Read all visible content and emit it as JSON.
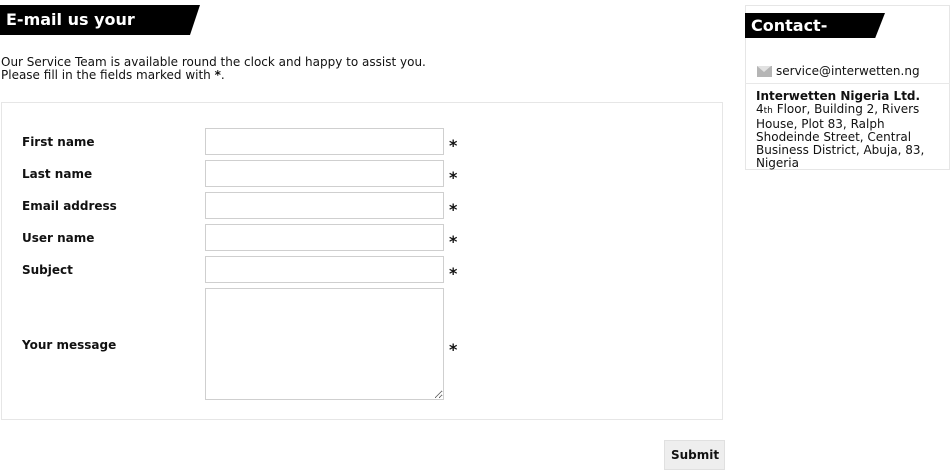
{
  "main_panel": {
    "title": "E-mail us your opinion",
    "intro_line1": "Our Service Team is available round the clock and happy to assist you.",
    "intro_line2_prefix": "Please fill in the fields marked with",
    "intro_line2_star": "*",
    "intro_line2_suffix": "."
  },
  "form": {
    "fields": [
      {
        "label": "First name",
        "value": "",
        "placeholder": ""
      },
      {
        "label": "Last name",
        "value": "",
        "placeholder": ""
      },
      {
        "label": "Email address",
        "value": "",
        "placeholder": ""
      },
      {
        "label": "User name",
        "value": "",
        "placeholder": ""
      },
      {
        "label": "Subject",
        "value": "",
        "placeholder": ""
      },
      {
        "label": "Your message",
        "value": "",
        "placeholder": ""
      }
    ],
    "required_marker": "*",
    "submit_label": "Submit"
  },
  "contact_centre": {
    "title": "Contact-Centre",
    "email": "service@interwetten.ng",
    "company": "Interwetten Nigeria Ltd.",
    "address_number": "4",
    "address_ordinal": "th",
    "address_rest": " Floor, Building 2, Rivers House, Plot 83, Ralph Shodeinde Street, Central Business District, Abuja, 83, Nigeria"
  }
}
